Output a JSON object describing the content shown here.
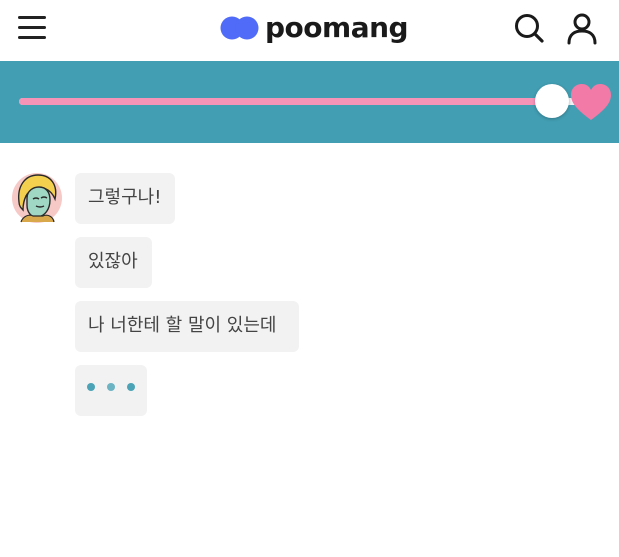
{
  "header": {
    "menu_icon": "hamburger-menu-icon",
    "logo_text": "poomang",
    "search_icon": "search-icon",
    "user_icon": "user-icon"
  },
  "colors": {
    "band": "#429eb3",
    "track": "#eef2f4",
    "progress_fill": "#f694b8",
    "heart": "#f17aa6",
    "bubble_bg": "#f2f2f2",
    "bubble_text": "#444444",
    "typing_dot": "#4aa3b6",
    "logo_blue": "#4f6bf7"
  },
  "progress": {
    "value": 0.95,
    "end_icon": "heart-icon"
  },
  "chat": {
    "avatar_icon": "character-avatar-icon",
    "messages": [
      {
        "text": "그렇구나!"
      },
      {
        "text": "있잖아"
      },
      {
        "text": "나 너한테 할 말이 있는데"
      }
    ],
    "typing_indicator": "typing-dots-icon"
  }
}
